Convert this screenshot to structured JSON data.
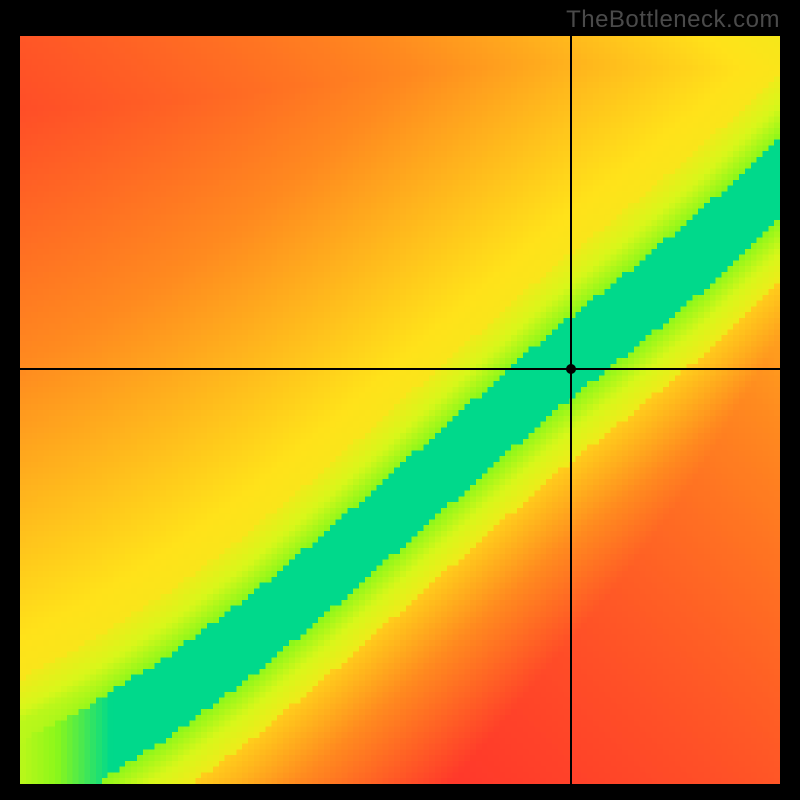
{
  "watermark": "TheBottleneck.com",
  "chart_data": {
    "type": "heatmap",
    "title": "",
    "xlabel": "",
    "ylabel": "",
    "xlim": [
      0,
      1
    ],
    "ylim": [
      0,
      1
    ],
    "crosshair": {
      "x": 0.725,
      "y": 0.555
    },
    "marker": {
      "x": 0.725,
      "y": 0.555
    },
    "grid_resolution": 130,
    "colorscale": [
      [
        0.0,
        "#ff1a2e"
      ],
      [
        0.35,
        "#ff8a1f"
      ],
      [
        0.55,
        "#ffe21a"
      ],
      [
        0.75,
        "#d8f71a"
      ],
      [
        0.88,
        "#8cf71a"
      ],
      [
        1.0,
        "#00d98b"
      ]
    ],
    "optimal_curve": [
      [
        0.0,
        0.0
      ],
      [
        0.1,
        0.055
      ],
      [
        0.2,
        0.12
      ],
      [
        0.3,
        0.195
      ],
      [
        0.4,
        0.28
      ],
      [
        0.5,
        0.37
      ],
      [
        0.6,
        0.46
      ],
      [
        0.7,
        0.55
      ],
      [
        0.8,
        0.63
      ],
      [
        0.9,
        0.715
      ],
      [
        1.0,
        0.81
      ]
    ],
    "green_band_halfwidth": 0.055,
    "yellow_band_halfwidth": 0.14
  }
}
